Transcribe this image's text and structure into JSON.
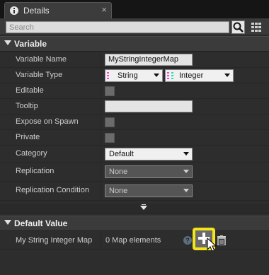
{
  "window": {
    "tab_title": "Details",
    "close_glyph": "×"
  },
  "search": {
    "placeholder": "Search",
    "search_icon": "magnifier-icon",
    "view_options_icon": "grid-icon"
  },
  "sections": {
    "variable": "Variable",
    "default_value": "Default Value"
  },
  "variable": {
    "rows": [
      {
        "label": "Variable Name",
        "value": "MyStringIntegerMap",
        "kind": "text"
      },
      {
        "label": "Variable Type",
        "key_type": "String",
        "value_type": "Integer",
        "kind": "type"
      },
      {
        "label": "Editable",
        "checked": false,
        "kind": "checkbox"
      },
      {
        "label": "Tooltip",
        "value": "",
        "kind": "text"
      },
      {
        "label": "Expose on Spawn",
        "checked": false,
        "kind": "checkbox"
      },
      {
        "label": "Private",
        "checked": false,
        "kind": "checkbox"
      },
      {
        "label": "Category",
        "value": "Default",
        "kind": "combo"
      },
      {
        "label": "Replication",
        "value": "None",
        "kind": "combo-disabled"
      },
      {
        "label": "Replication Condition",
        "value": "None",
        "kind": "combo-disabled"
      }
    ]
  },
  "default_value": {
    "label": "My String Integer Map",
    "value": "0 Map elements",
    "help_glyph": "?"
  },
  "colors": {
    "string_pin": "#ff44d8",
    "integer_pin": "#1fe3b1",
    "highlight": "#f3e51a"
  }
}
